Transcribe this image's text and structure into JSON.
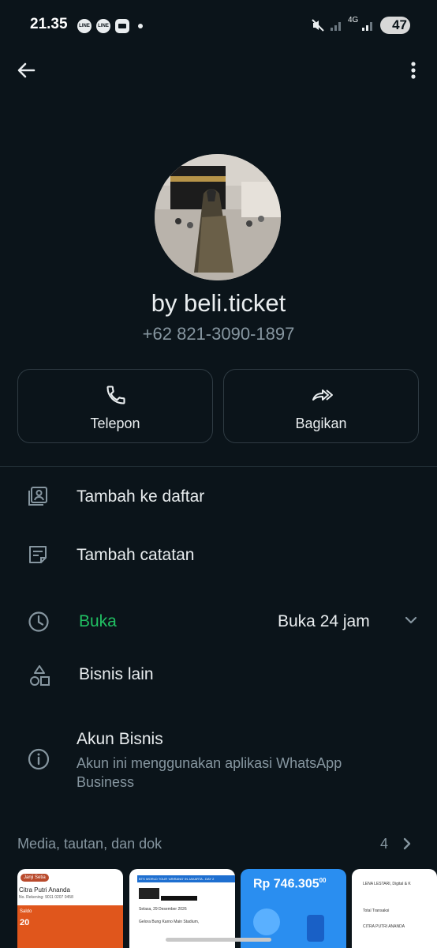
{
  "status_bar": {
    "time": "21.35",
    "notif_icons": [
      "LINE",
      "LINE",
      "chat"
    ],
    "network": "4G",
    "battery": "47"
  },
  "header": {
    "back_icon": "arrow-left-icon",
    "menu_icon": "more-vertical-icon"
  },
  "profile": {
    "name": "by beli.ticket",
    "phone": "+62 821-3090-1897"
  },
  "actions": [
    {
      "label": "Telepon",
      "icon": "phone-icon"
    },
    {
      "label": "Bagikan",
      "icon": "share-forward-icon"
    }
  ],
  "menu": {
    "add_to_list": "Tambah ke daftar",
    "add_note": "Tambah catatan",
    "hours_status": "Buka",
    "hours_value": "Buka 24 jam",
    "other_business": "Bisnis lain",
    "business_account_title": "Akun Bisnis",
    "business_account_desc": "Akun ini menggunakan aplikasi WhatsApp Business"
  },
  "media": {
    "label": "Media, tautan, dan dok",
    "count": "4",
    "thumbs": [
      {
        "title": "Janji Setia",
        "line1": "Citra Putri Ananda",
        "line2": "No. Rekening: 9011 0207 0458",
        "line3": "Saldo",
        "line4": "20"
      },
      {
        "title": "BTS WORLD TOUR 'ARIRANG' IN JAKARTA - DAY 2",
        "line1": "Selasa, 29 Desember 2026",
        "line2": "Gelora Bung Karno Main Stadium,"
      },
      {
        "title": "Rp 746.305",
        "superscript": "00"
      },
      {
        "title": "LENA LESTARI, Digital & K",
        "line1": "Total Transaksi",
        "line2": "CITRA PUTRI ANANDA"
      }
    ]
  },
  "colors": {
    "background": "#0b141a",
    "text_primary": "#e9edef",
    "text_secondary": "#8696a0",
    "accent_green": "#21c063",
    "border": "#2f3b43"
  }
}
